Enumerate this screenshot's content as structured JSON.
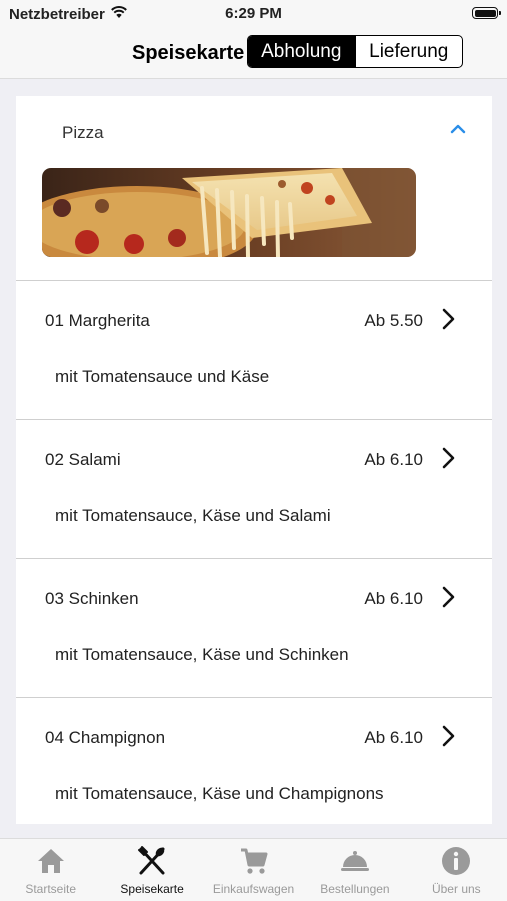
{
  "status_bar": {
    "carrier": "Netzbetreiber",
    "time": "6:29 PM",
    "wifi_icon": "wifi-icon",
    "battery_icon": "battery-icon"
  },
  "nav": {
    "title": "Speisekarte",
    "segments": [
      {
        "label": "Abholung",
        "selected": true
      },
      {
        "label": "Lieferung",
        "selected": false
      }
    ]
  },
  "category": {
    "title": "Pizza",
    "expanded": true,
    "toggle_icon": "chevron-up-icon",
    "image": "pizza-photo"
  },
  "items": [
    {
      "name": "01 Margherita",
      "price": "Ab 5.50",
      "description": "mit Tomatensauce und Käse"
    },
    {
      "name": "02 Salami",
      "price": "Ab 6.10",
      "description": "mit Tomatensauce, Käse und Salami"
    },
    {
      "name": "03 Schinken",
      "price": "Ab 6.10",
      "description": "mit Tomatensauce, Käse und Schinken"
    },
    {
      "name": "04 Champignon",
      "price": "Ab 6.10",
      "description": "mit Tomatensauce, Käse und Champignons"
    }
  ],
  "tabs": [
    {
      "label": "Startseite",
      "icon": "home-icon",
      "active": false
    },
    {
      "label": "Speisekarte",
      "icon": "utensils-icon",
      "active": true
    },
    {
      "label": "Einkaufswagen",
      "icon": "cart-icon",
      "active": false
    },
    {
      "label": "Bestellungen",
      "icon": "cloche-icon",
      "active": false
    },
    {
      "label": "Über uns",
      "icon": "info-icon",
      "active": false
    }
  ],
  "colors": {
    "accent": "#2a8ee8",
    "tab_active": "#111111",
    "tab_inactive": "#9a9a9a",
    "segment_selected_bg": "#000000"
  }
}
